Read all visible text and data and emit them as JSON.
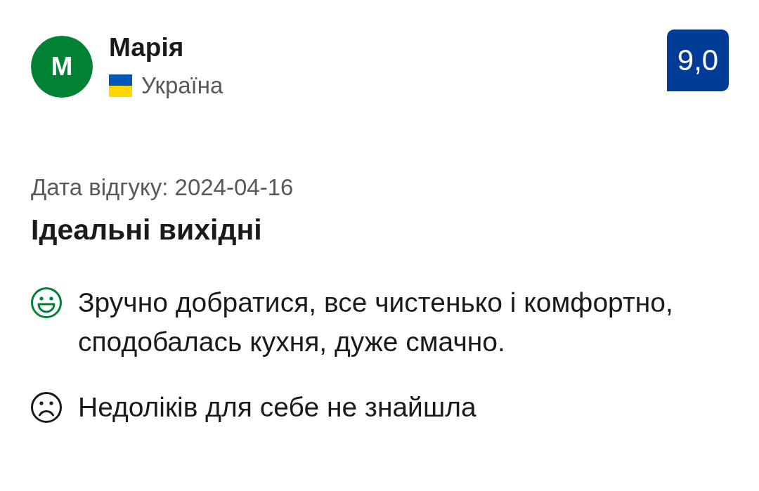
{
  "reviewer": {
    "initial": "М",
    "name": "Марія",
    "country": "Україна"
  },
  "score": "9,0",
  "review": {
    "date_label": "Дата відгуку: 2024-04-16",
    "title": "Ідеальні вихідні",
    "comments": [
      {
        "kind": "positive",
        "text": "Зручно добратися, все чистенько і комфортно, сподобалась кухня, дуже смачно."
      },
      {
        "kind": "negative",
        "text": "Недоліків для себе не знайшла"
      }
    ]
  }
}
